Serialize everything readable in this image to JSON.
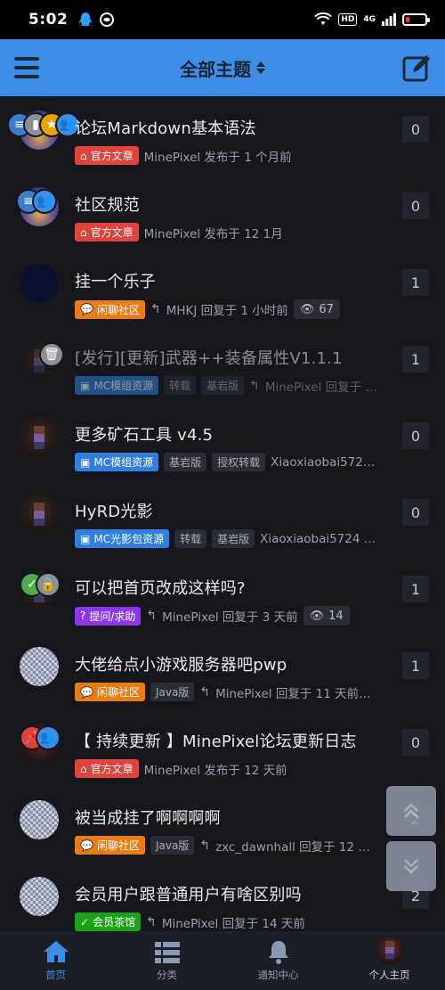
{
  "status_bar": {
    "time": "5:02",
    "network": "4G",
    "hd": "HD"
  },
  "header": {
    "title": "全部主题"
  },
  "topics": [
    {
      "title": "论坛Markdown基本语法",
      "category": "官方文章",
      "meta": "MinePixel 发布于 1 个月前",
      "count": "0"
    },
    {
      "title": "社区规范",
      "category": "官方文章",
      "meta": "MinePixel 发布于 12 1月",
      "count": "0"
    },
    {
      "title": "挂一个乐子",
      "category": "闲聊社区",
      "meta": "MHKJ 回复于 1 小时前",
      "views": "67",
      "count": "1"
    },
    {
      "title": "[发行][更新]武器++装备属性V1.1.1",
      "category": "MC模组资源",
      "tags": [
        "转载",
        "基岩版"
      ],
      "meta": "MinePixel 回复于 …",
      "count": "1"
    },
    {
      "title": "更多矿石工具 v4.5",
      "category": "MC模组资源",
      "tags": [
        "基岩版",
        "授权转载"
      ],
      "meta": "Xiaoxiaobai572…",
      "count": "0"
    },
    {
      "title": "HyRD光影",
      "category": "MC光影包资源",
      "tags": [
        "转载",
        "基岩版"
      ],
      "meta": "Xiaoxiaobai5724 …",
      "count": "0"
    },
    {
      "title": "可以把首页改成这样吗?",
      "category": "提问/求助",
      "meta": "MinePixel 回复于 3 天前",
      "views": "14",
      "count": "1"
    },
    {
      "title": "大佬给点小游戏服务器吧pwp",
      "category": "闲聊社区",
      "tags": [
        "Java版"
      ],
      "meta": "MinePixel 回复于 11 天前…",
      "count": "1"
    },
    {
      "title": "【 持续更新 】MinePixel论坛更新日志",
      "category": "官方文章",
      "meta": "MinePixel 发布于 12 天前",
      "count": "0"
    },
    {
      "title": "被当成挂了啊啊啊啊",
      "category": "闲聊社区",
      "tags": [
        "Java版"
      ],
      "meta": "zxc_dawnhall 回复于 12 …",
      "count": "2"
    },
    {
      "title": "会员用户跟普通用户有啥区别吗",
      "category": "会员茶馆",
      "meta": "MinePixel 回复于 14 天前",
      "count": "2"
    }
  ],
  "bottom_nav": {
    "home": "首页",
    "categories": "分类",
    "notifications": "通知中心",
    "profile": "个人主页"
  }
}
